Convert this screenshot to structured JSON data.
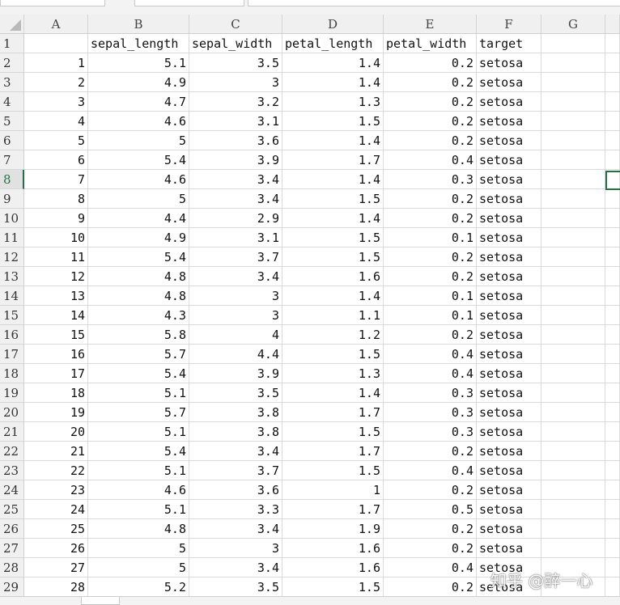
{
  "columns": [
    "A",
    "B",
    "C",
    "D",
    "E",
    "F",
    "G"
  ],
  "header_row": {
    "row": "1",
    "values": [
      "",
      "sepal_length",
      "sepal_width",
      "petal_length",
      "petal_width",
      "target",
      ""
    ]
  },
  "rows": [
    {
      "row": "2",
      "a": "1",
      "b": "5.1",
      "c": "3.5",
      "d": "1.4",
      "e": "0.2",
      "f": "setosa"
    },
    {
      "row": "3",
      "a": "2",
      "b": "4.9",
      "c": "3",
      "d": "1.4",
      "e": "0.2",
      "f": "setosa"
    },
    {
      "row": "4",
      "a": "3",
      "b": "4.7",
      "c": "3.2",
      "d": "1.3",
      "e": "0.2",
      "f": "setosa"
    },
    {
      "row": "5",
      "a": "4",
      "b": "4.6",
      "c": "3.1",
      "d": "1.5",
      "e": "0.2",
      "f": "setosa"
    },
    {
      "row": "6",
      "a": "5",
      "b": "5",
      "c": "3.6",
      "d": "1.4",
      "e": "0.2",
      "f": "setosa"
    },
    {
      "row": "7",
      "a": "6",
      "b": "5.4",
      "c": "3.9",
      "d": "1.7",
      "e": "0.4",
      "f": "setosa"
    },
    {
      "row": "8",
      "a": "7",
      "b": "4.6",
      "c": "3.4",
      "d": "1.4",
      "e": "0.3",
      "f": "setosa"
    },
    {
      "row": "9",
      "a": "8",
      "b": "5",
      "c": "3.4",
      "d": "1.5",
      "e": "0.2",
      "f": "setosa"
    },
    {
      "row": "10",
      "a": "9",
      "b": "4.4",
      "c": "2.9",
      "d": "1.4",
      "e": "0.2",
      "f": "setosa"
    },
    {
      "row": "11",
      "a": "10",
      "b": "4.9",
      "c": "3.1",
      "d": "1.5",
      "e": "0.1",
      "f": "setosa"
    },
    {
      "row": "12",
      "a": "11",
      "b": "5.4",
      "c": "3.7",
      "d": "1.5",
      "e": "0.2",
      "f": "setosa"
    },
    {
      "row": "13",
      "a": "12",
      "b": "4.8",
      "c": "3.4",
      "d": "1.6",
      "e": "0.2",
      "f": "setosa"
    },
    {
      "row": "14",
      "a": "13",
      "b": "4.8",
      "c": "3",
      "d": "1.4",
      "e": "0.1",
      "f": "setosa"
    },
    {
      "row": "15",
      "a": "14",
      "b": "4.3",
      "c": "3",
      "d": "1.1",
      "e": "0.1",
      "f": "setosa"
    },
    {
      "row": "16",
      "a": "15",
      "b": "5.8",
      "c": "4",
      "d": "1.2",
      "e": "0.2",
      "f": "setosa"
    },
    {
      "row": "17",
      "a": "16",
      "b": "5.7",
      "c": "4.4",
      "d": "1.5",
      "e": "0.4",
      "f": "setosa"
    },
    {
      "row": "18",
      "a": "17",
      "b": "5.4",
      "c": "3.9",
      "d": "1.3",
      "e": "0.4",
      "f": "setosa"
    },
    {
      "row": "19",
      "a": "18",
      "b": "5.1",
      "c": "3.5",
      "d": "1.4",
      "e": "0.3",
      "f": "setosa"
    },
    {
      "row": "20",
      "a": "19",
      "b": "5.7",
      "c": "3.8",
      "d": "1.7",
      "e": "0.3",
      "f": "setosa"
    },
    {
      "row": "21",
      "a": "20",
      "b": "5.1",
      "c": "3.8",
      "d": "1.5",
      "e": "0.3",
      "f": "setosa"
    },
    {
      "row": "22",
      "a": "21",
      "b": "5.4",
      "c": "3.4",
      "d": "1.7",
      "e": "0.2",
      "f": "setosa"
    },
    {
      "row": "23",
      "a": "22",
      "b": "5.1",
      "c": "3.7",
      "d": "1.5",
      "e": "0.4",
      "f": "setosa"
    },
    {
      "row": "24",
      "a": "23",
      "b": "4.6",
      "c": "3.6",
      "d": "1",
      "e": "0.2",
      "f": "setosa"
    },
    {
      "row": "25",
      "a": "24",
      "b": "5.1",
      "c": "3.3",
      "d": "1.7",
      "e": "0.5",
      "f": "setosa"
    },
    {
      "row": "26",
      "a": "25",
      "b": "4.8",
      "c": "3.4",
      "d": "1.9",
      "e": "0.2",
      "f": "setosa"
    },
    {
      "row": "27",
      "a": "26",
      "b": "5",
      "c": "3",
      "d": "1.6",
      "e": "0.2",
      "f": "setosa"
    },
    {
      "row": "28",
      "a": "27",
      "b": "5",
      "c": "3.4",
      "d": "1.6",
      "e": "0.4",
      "f": "setosa"
    },
    {
      "row": "29",
      "a": "28",
      "b": "5.2",
      "c": "3.5",
      "d": "1.5",
      "e": "0.2",
      "f": "setosa"
    }
  ],
  "active_row": "8",
  "watermark": "知乎 @醉一心",
  "colors": {
    "accent": "#217346",
    "grid": "#dadada",
    "header_bg": "#f0f0f0"
  }
}
